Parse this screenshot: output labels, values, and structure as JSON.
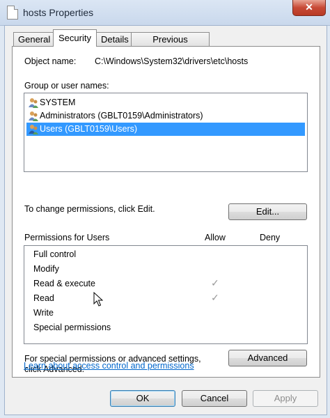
{
  "window": {
    "title": "hosts Properties",
    "close_glyph": "✕"
  },
  "tabs": [
    {
      "label": "General"
    },
    {
      "label": "Security"
    },
    {
      "label": "Details"
    },
    {
      "label": "Previous Versions"
    }
  ],
  "security": {
    "object_name_label": "Object name:",
    "object_name_value": "C:\\Windows\\System32\\drivers\\etc\\hosts",
    "group_label": "Group or user names:",
    "groups": [
      {
        "name": "SYSTEM",
        "icon": "users-icon"
      },
      {
        "name": "Administrators (GBLT0159\\Administrators)",
        "icon": "users-icon"
      },
      {
        "name": "Users (GBLT0159\\Users)",
        "icon": "users-icon",
        "selected": true
      }
    ],
    "change_text": "To change permissions, click Edit.",
    "edit_label": "Edit...",
    "permissions_for": "Permissions for Users",
    "allow_header": "Allow",
    "deny_header": "Deny",
    "permissions": [
      {
        "name": "Full control",
        "allow": false,
        "deny": false
      },
      {
        "name": "Modify",
        "allow": false,
        "deny": false
      },
      {
        "name": "Read & execute",
        "allow": true,
        "deny": false
      },
      {
        "name": "Read",
        "allow": true,
        "deny": false
      },
      {
        "name": "Write",
        "allow": false,
        "deny": false
      },
      {
        "name": "Special permissions",
        "allow": false,
        "deny": false
      }
    ],
    "check_glyph": "✓",
    "advanced_text_1": "For special permissions or advanced settings,",
    "advanced_text_2": "click Advanced.",
    "advanced_label": "Advanced",
    "learn_link": "Learn about access control and permissions"
  },
  "footer": {
    "ok": "OK",
    "cancel": "Cancel",
    "apply": "Apply"
  },
  "colors": {
    "selection": "#3399ff",
    "link": "#0066cc",
    "close": "#c74a36"
  }
}
